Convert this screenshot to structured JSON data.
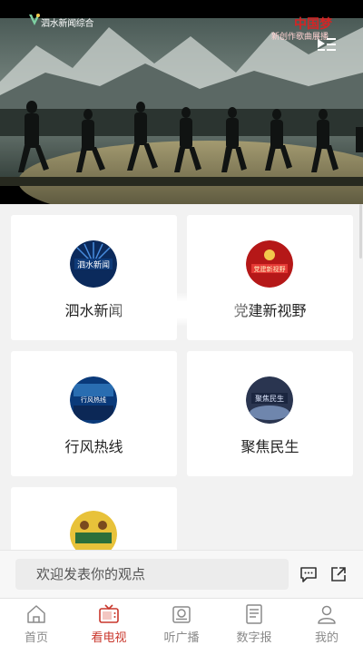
{
  "player": {
    "channel_name": "泗水新闻综合",
    "osd_title": "中国梦",
    "osd_subtitle": "新创作歌曲展播"
  },
  "cards": [
    {
      "title": "泗水新闻",
      "logo_text": "泗水新闻",
      "logo_colors": [
        "#0b2a5c",
        "#1f6fd1"
      ]
    },
    {
      "title": "党建新视野",
      "logo_text": "党建新视野",
      "logo_colors": [
        "#8c0d0d",
        "#d42a1f"
      ]
    },
    {
      "title": "行风热线",
      "logo_text": "行风热线",
      "logo_colors": [
        "#0a3a7a",
        "#53a7e8"
      ]
    },
    {
      "title": "聚焦民生",
      "logo_text": "聚焦民生",
      "logo_colors": [
        "#3a4a6a",
        "#9ab3d6"
      ]
    },
    {
      "title": "",
      "logo_text": "",
      "logo_colors": [
        "#2c6f3a",
        "#e8c23a"
      ]
    }
  ],
  "comment": {
    "placeholder": "欢迎发表你的观点"
  },
  "tabs": [
    {
      "label": "首页",
      "icon": "home-icon",
      "active": false
    },
    {
      "label": "看电视",
      "icon": "tv-icon",
      "active": true
    },
    {
      "label": "听广播",
      "icon": "radio-icon",
      "active": false
    },
    {
      "label": "数字报",
      "icon": "newspaper-icon",
      "active": false
    },
    {
      "label": "我的",
      "icon": "user-icon",
      "active": false
    }
  ],
  "colors": {
    "accent": "#c9372c",
    "inactive": "#8a8a8a"
  }
}
